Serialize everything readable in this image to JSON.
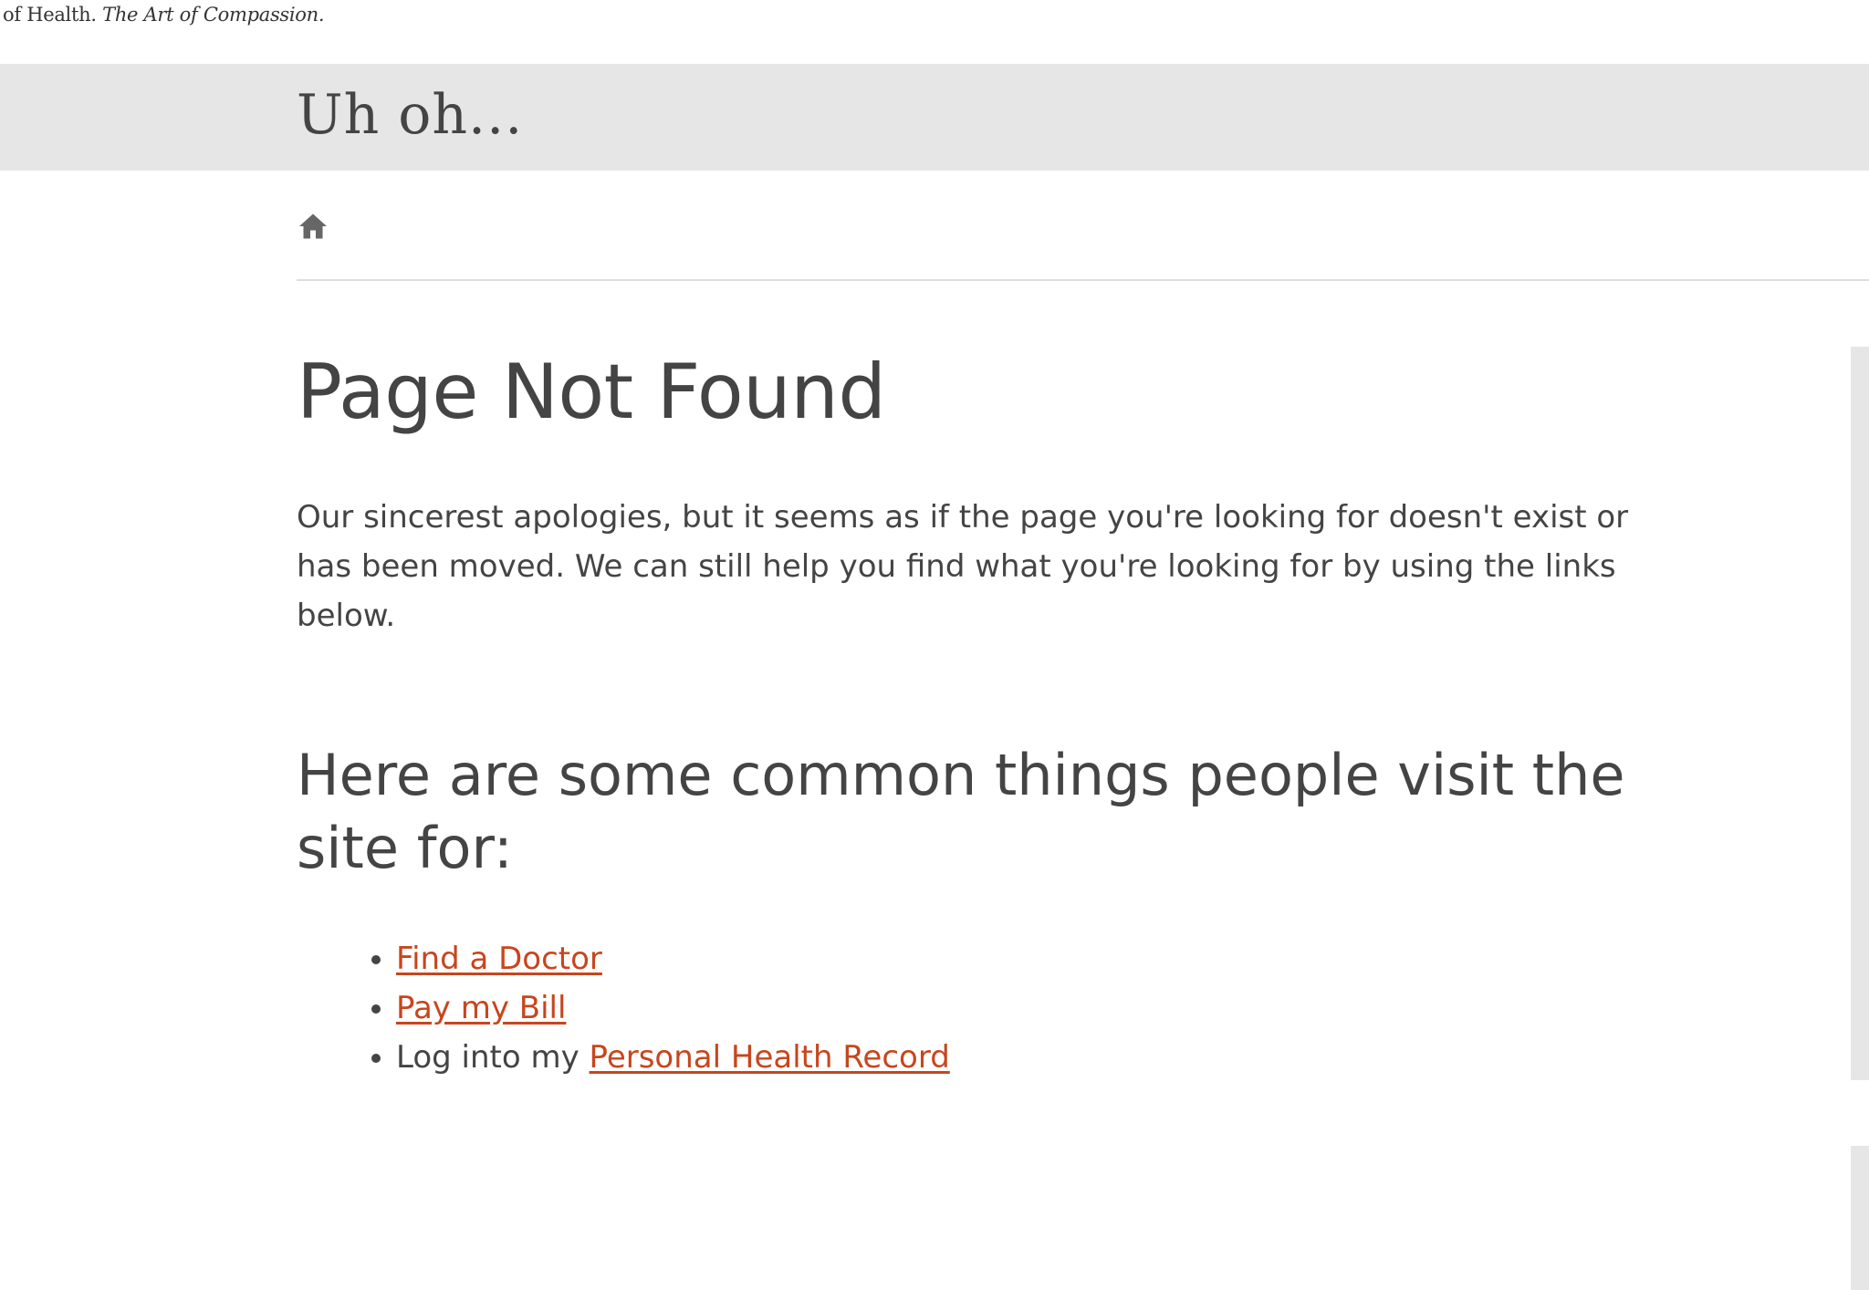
{
  "header": {
    "tagline_prefix": "of Health.",
    "tagline_italic": "The Art of Compassion."
  },
  "banner": {
    "title": "Uh oh..."
  },
  "breadcrumb": {
    "home_icon": "home-icon"
  },
  "main": {
    "heading": "Page Not Found",
    "intro": "Our sincerest apologies, but it seems as if the page you're looking for doesn't exist or has been moved. We can still help you find what you're looking for by using the links below.",
    "subheading": "Here are some common things people visit the site for:",
    "links": [
      {
        "prefix": "",
        "label": "Find a Doctor"
      },
      {
        "prefix": "",
        "label": "Pay my Bill"
      },
      {
        "prefix": "Log into my ",
        "label": "Personal Health Record"
      }
    ]
  },
  "colors": {
    "link": "#c7461d",
    "banner_bg": "#e6e6e6",
    "text": "#444444"
  }
}
